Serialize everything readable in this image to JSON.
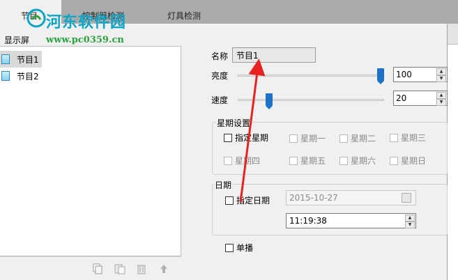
{
  "watermark": {
    "site_name": "河东软件园",
    "url": "www.pc0359.cn"
  },
  "tabs": [
    {
      "label": "节目",
      "active": true
    },
    {
      "label": "控制器检测",
      "active": false
    },
    {
      "label": "灯具检测",
      "active": false
    }
  ],
  "screen_panel": {
    "title": "显示屏",
    "items": [
      {
        "label": "节目1",
        "selected": true
      },
      {
        "label": "节目2",
        "selected": false
      }
    ],
    "toolbar": [
      "copy-icon",
      "paste-icon",
      "trash-icon",
      "move-up-icon"
    ]
  },
  "program": {
    "name_label": "名称",
    "name_value": "节目1",
    "brightness_label": "亮度",
    "brightness_value": "100",
    "brightness_level": 1.0,
    "speed_label": "速度",
    "speed_value": "20",
    "speed_level": 0.2
  },
  "week_settings": {
    "title": "星期设置",
    "specify_label": "指定星期",
    "days": [
      "星期一",
      "星期二",
      "星期三",
      "星期四",
      "星期五",
      "星期六",
      "星期日"
    ]
  },
  "date_settings": {
    "title": "日期",
    "specify_label": "指定日期",
    "date_value": "2015-10-27",
    "time_value": "11:19:38"
  },
  "single_play_label": "单播",
  "colors": {
    "accent": "#1c74c9",
    "arrow": "#e8231f",
    "watermark_blue": "#0da6c9",
    "watermark_green": "#29a23d"
  }
}
